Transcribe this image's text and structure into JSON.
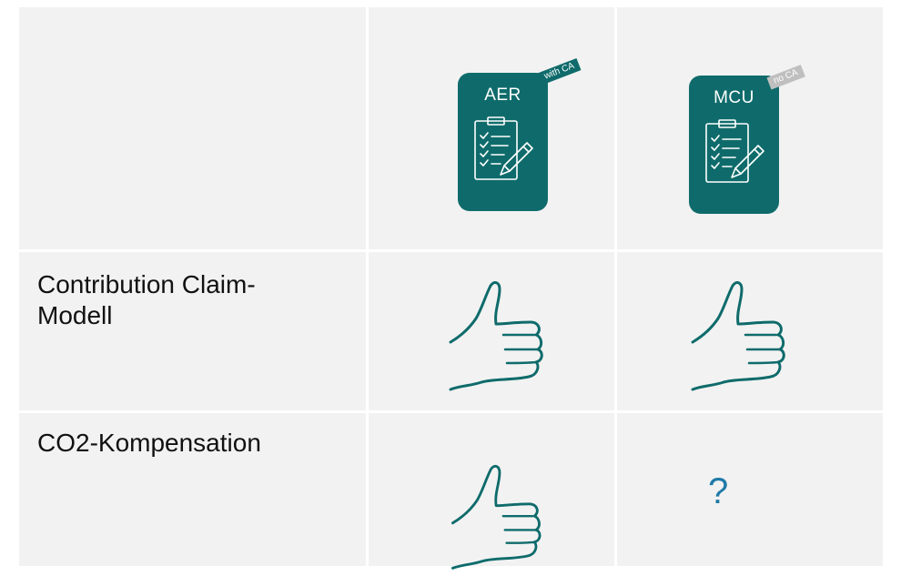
{
  "columns": [
    {
      "card_title": "AER",
      "ribbon": "with CA",
      "ribbon_style": "dark"
    },
    {
      "card_title": "MCU",
      "ribbon": "no CA",
      "ribbon_style": "grey"
    }
  ],
  "rows": [
    {
      "label_line1": "Contribution Claim-",
      "label_line2": "Modell",
      "col1_icon": "thumbs-up-icon",
      "col2_icon": "thumbs-up-icon"
    },
    {
      "label_line1": "CO2-Kompensation",
      "col1_icon": "thumbs-up-icon",
      "col2_symbol": "?"
    }
  ],
  "colors": {
    "card": "#0f6b6b",
    "cell_bg": "#f2f2f2",
    "thumb_stroke": "#0f6b6b",
    "question": "#1f7aa8",
    "ribbon_grey": "#bfbfbf"
  }
}
